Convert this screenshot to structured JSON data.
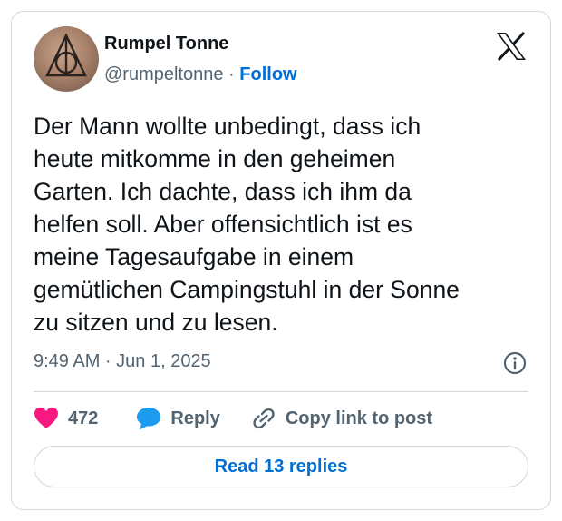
{
  "tweet": {
    "author_name": "Rumpel Tonne",
    "handle": "@rumpeltonne",
    "separator": "·",
    "follow_label": "Follow",
    "text": "Der Mann wollte unbedingt, dass ich\nheute mitkomme in den geheimen\nGarten. Ich dachte, dass ich ihm da\nhelfen soll. Aber offensichtlich ist es\nmeine Tagesaufgabe in einem\ngemütlichen Campingstuhl in der Sonne\nzu sitzen und zu lesen.",
    "timestamp": "9:49 AM · Jun 1, 2025"
  },
  "actions": {
    "like_count": "472",
    "reply_label": "Reply",
    "copy_link_label": "Copy link to post"
  },
  "footer": {
    "read_replies_label": "Read 13 replies"
  },
  "icons": {
    "logo": "x-logo-icon",
    "info": "info-icon",
    "like": "heart-icon",
    "reply": "speech-bubble-icon",
    "copy": "link-icon"
  },
  "colors": {
    "accent": "#006fd6",
    "heart": "#f91880",
    "reply": "#1d9bf0",
    "muted": "#536471",
    "border": "#cfd9de"
  }
}
